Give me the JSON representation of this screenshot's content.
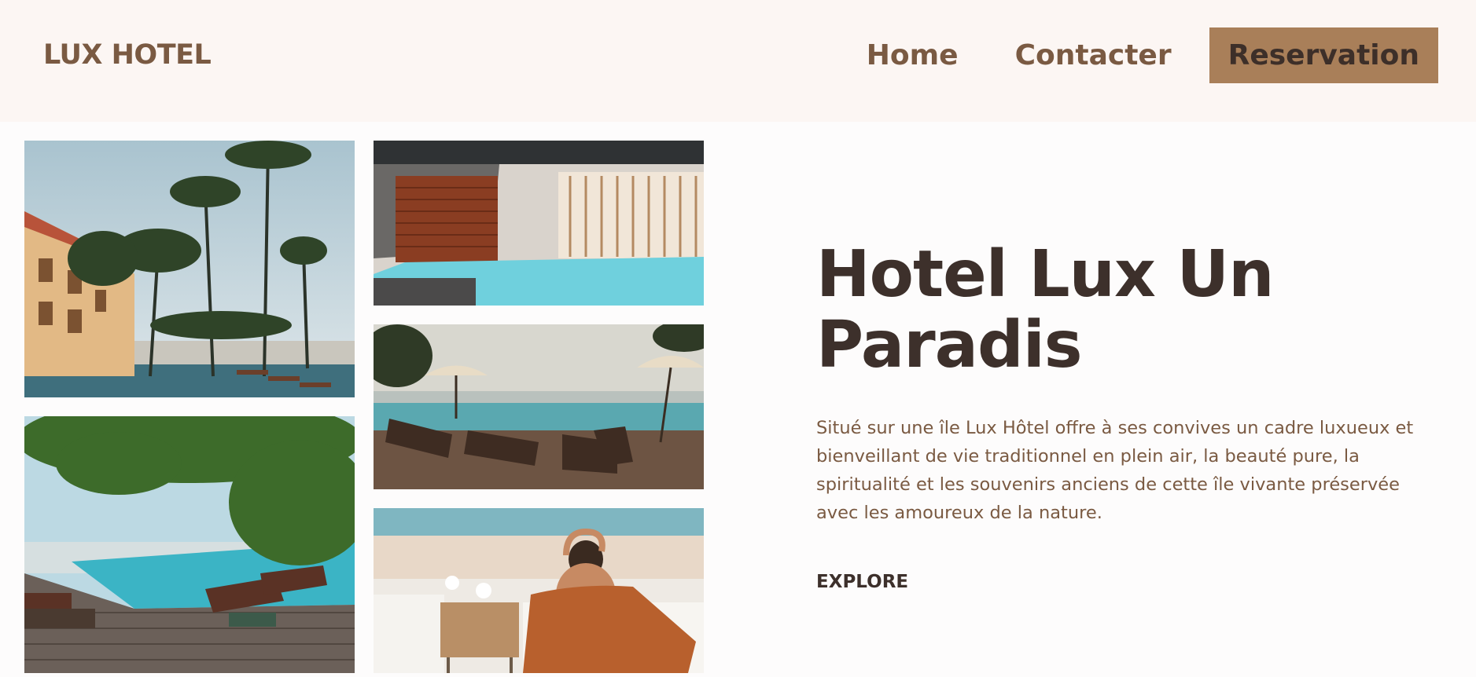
{
  "brand": {
    "logo_text": "LUX HOTEL"
  },
  "nav": {
    "home": "Home",
    "contact": "Contacter",
    "reservation": "Reservation"
  },
  "hero": {
    "title_line1": "Hotel Lux Un",
    "title_line2": "Paradis",
    "description": "Situé sur une île Lux Hôtel offre à ses convives un cadre luxueux et bienveillant de vie traditionnel en plein air, la beauté pure, la spiritualité et les souvenirs anciens de cette île vivante préservée avec les amoureux de la nature.",
    "explore_label": "EXPLORE"
  },
  "gallery": {
    "photos": [
      "palm-trees-resort-photo",
      "indoor-pool-photo",
      "sea-view-sunbeds-photo",
      "infinity-pool-tropical-photo",
      "woman-relaxing-by-pool-photo"
    ]
  },
  "colors": {
    "header_bg": "#fcf6f3",
    "page_bg": "#fdfcfc",
    "brand_brown": "#7a5a42",
    "cta_bg": "#a97f59",
    "title_dark": "#3d302b"
  }
}
